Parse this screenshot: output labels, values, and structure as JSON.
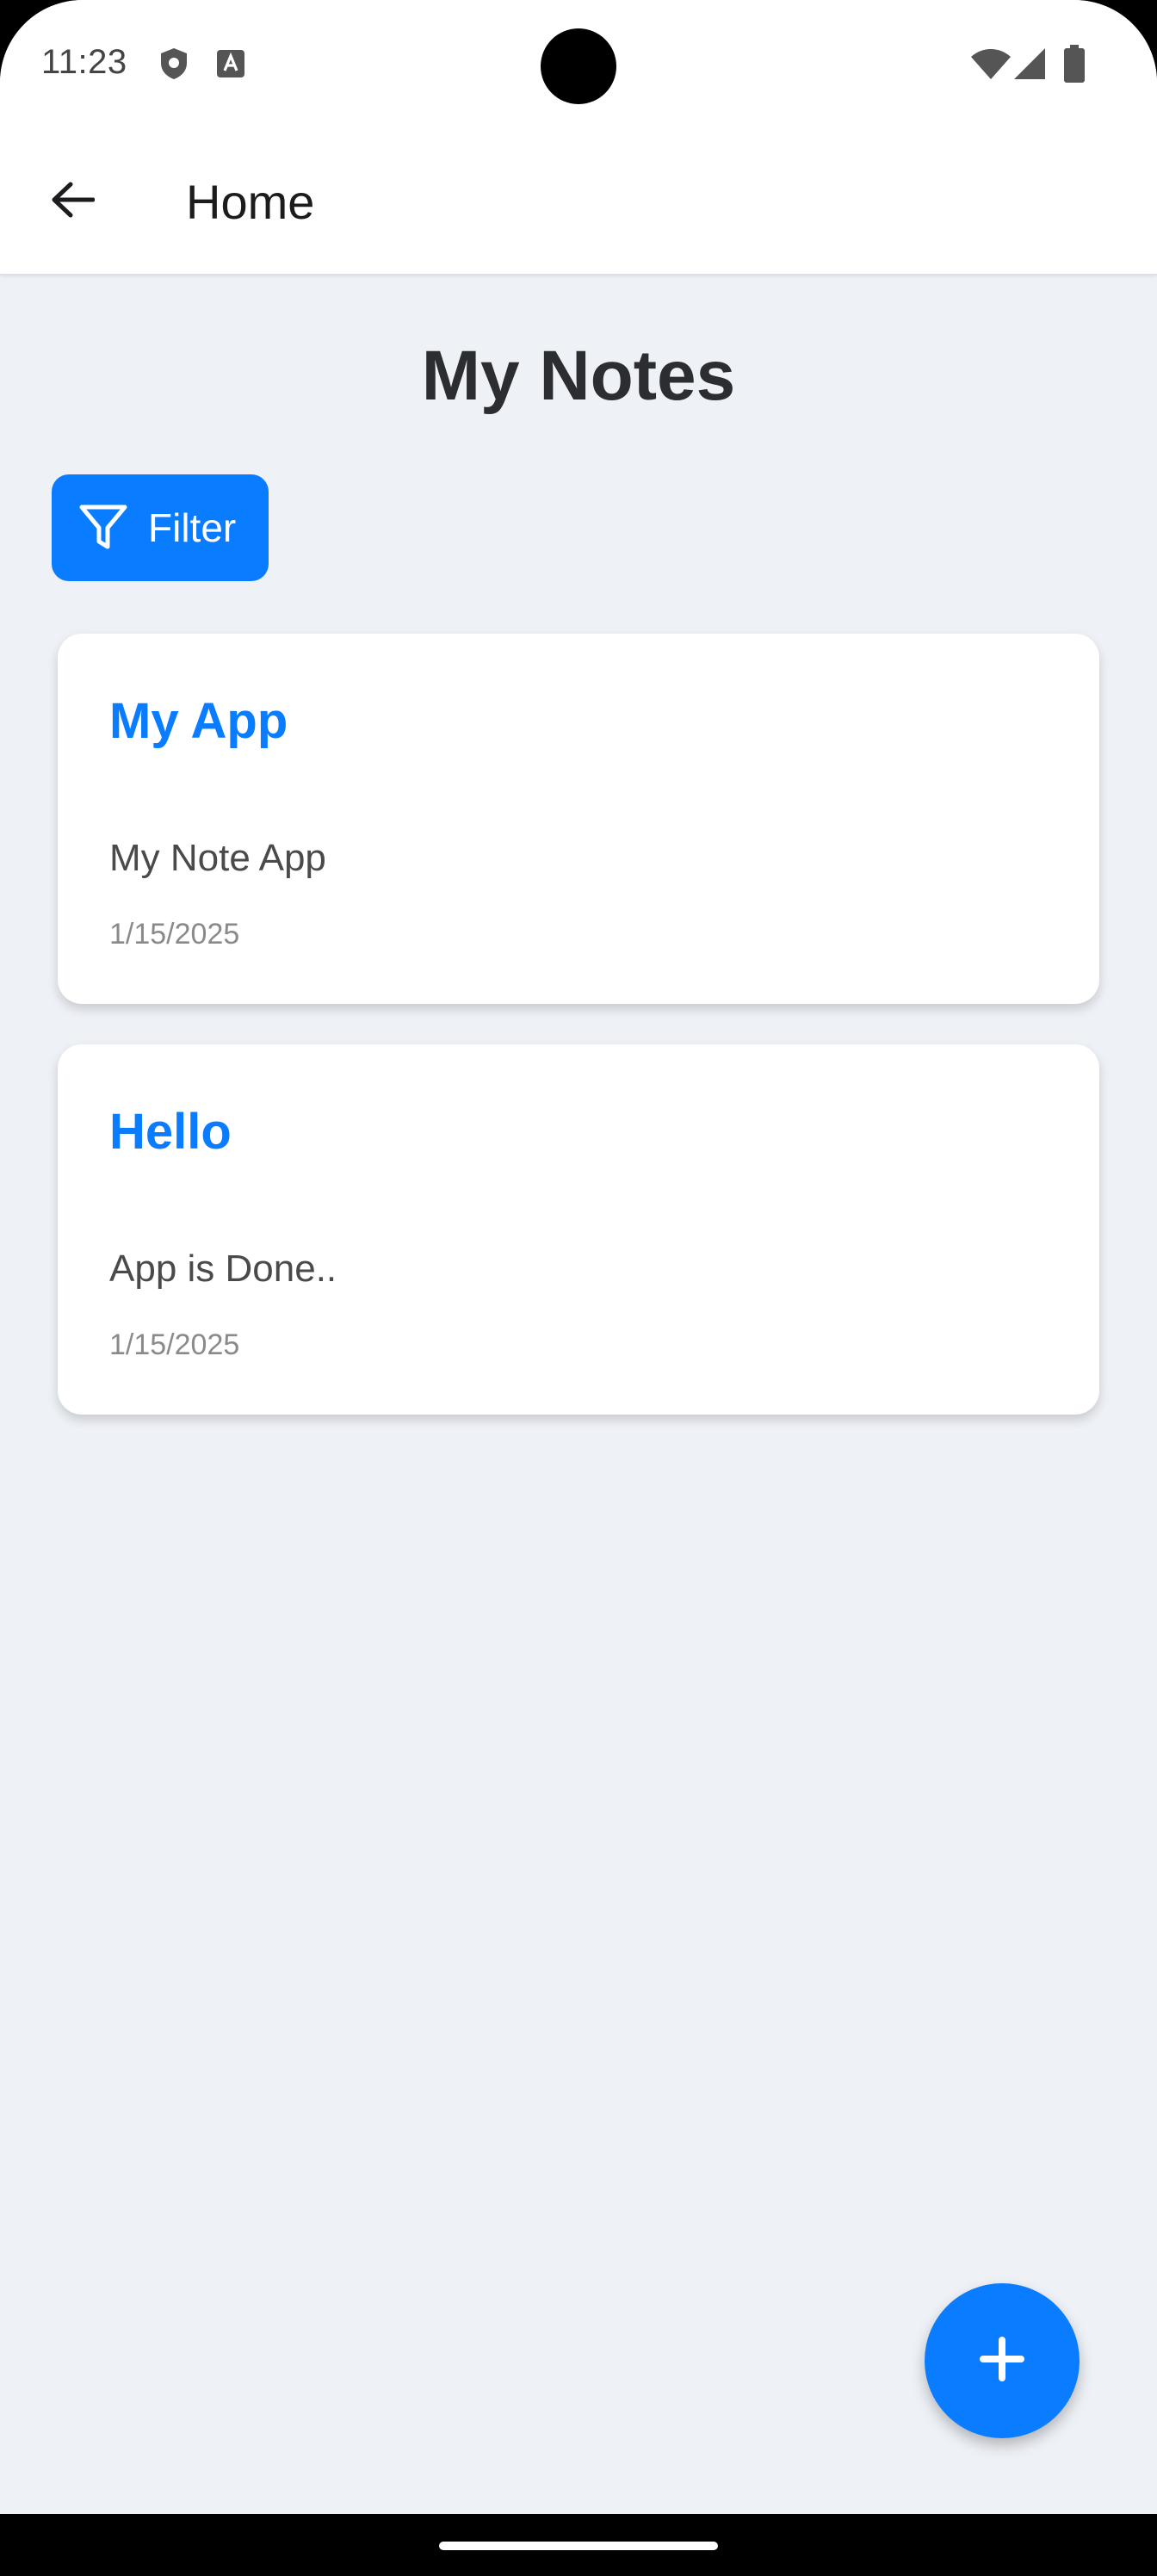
{
  "status_bar": {
    "time": "11:23",
    "left_icons": [
      "shield-icon",
      "font-icon"
    ],
    "right_icons": [
      "wifi-icon",
      "signal-icon",
      "battery-icon"
    ]
  },
  "app_bar": {
    "back_icon": "arrow-left-icon",
    "title": "Home"
  },
  "page": {
    "title": "My Notes",
    "filter_label": "Filter",
    "filter_icon": "funnel-icon"
  },
  "notes": [
    {
      "title": "My App",
      "body": "My Note App",
      "date": "1/15/2025"
    },
    {
      "title": "Hello",
      "body": "App is Done..",
      "date": "1/15/2025"
    }
  ],
  "fab": {
    "icon": "plus-icon"
  },
  "colors": {
    "accent": "#0a7cff",
    "background": "#eef1f6",
    "card": "#ffffff",
    "title_text": "#2b2d31"
  }
}
